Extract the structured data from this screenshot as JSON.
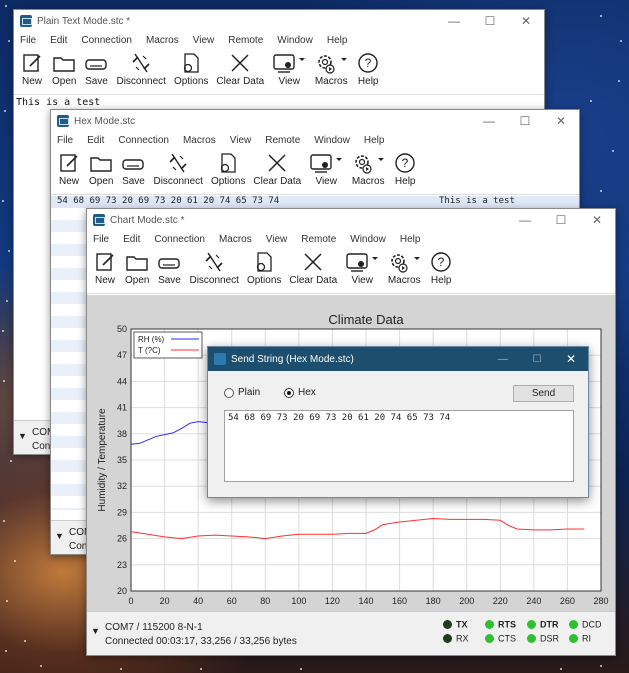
{
  "plain_window": {
    "title": "Plain Text Mode.stc *",
    "text": "This is a test",
    "status_port": "COM",
    "status_conn": "Conn"
  },
  "hex_window": {
    "title": "Hex Mode.stc",
    "hex_text": "54 68 69 73 20 69 73 20 61 20 74 65 73 74",
    "ascii_text": "This is a test",
    "status_port": "COM",
    "status_conn": "Con"
  },
  "chart_window": {
    "title": "Chart Mode.stc *",
    "status_port": "COM7 / 115200 8-N-1",
    "status_conn": "Connected 00:03:17, 33,256 / 33,256 bytes"
  },
  "menu": [
    "File",
    "Edit",
    "Connection",
    "Macros",
    "View",
    "Remote",
    "Window",
    "Help"
  ],
  "toolbar": [
    {
      "label": "New",
      "icon": "new-file-icon"
    },
    {
      "label": "Open",
      "icon": "folder-icon"
    },
    {
      "label": "Save",
      "icon": "save-drive-icon"
    },
    {
      "label": "Disconnect",
      "icon": "disconnect-icon"
    },
    {
      "label": "Options",
      "icon": "options-gear-icon"
    },
    {
      "label": "Clear Data",
      "icon": "clear-x-icon"
    },
    {
      "label": "View",
      "icon": "view-monitor-icon"
    },
    {
      "label": "Macros",
      "icon": "macros-gear-icon"
    },
    {
      "label": "Help",
      "icon": "help-icon"
    }
  ],
  "signals": [
    {
      "label": "TX",
      "state": "dark",
      "bold": true
    },
    {
      "label": "RX",
      "state": "dark",
      "bold": false
    },
    {
      "label": "RTS",
      "state": "on",
      "bold": true
    },
    {
      "label": "CTS",
      "state": "on",
      "bold": false
    },
    {
      "label": "DTR",
      "state": "on",
      "bold": true
    },
    {
      "label": "DSR",
      "state": "on",
      "bold": false
    },
    {
      "label": "DCD",
      "state": "on",
      "bold": false
    },
    {
      "label": "RI",
      "state": "on",
      "bold": false
    }
  ],
  "dialog": {
    "title": "Send String (Hex Mode.stc)",
    "option_plain": "Plain",
    "option_hex": "Hex",
    "selected": "Hex",
    "send_label": "Send",
    "text": "54 68 69 73 20 69 73 20 61 20 74 65 73 74"
  },
  "chart_data": {
    "type": "line",
    "title": "Climate Data",
    "xlabel": "",
    "ylabel": "Humidity / Temperature",
    "xlim": [
      0,
      280
    ],
    "ylim": [
      20,
      50
    ],
    "xticks": [
      0,
      20,
      40,
      60,
      80,
      100,
      120,
      140,
      160,
      180,
      200,
      220,
      240,
      260,
      280
    ],
    "yticks": [
      20,
      23,
      26,
      29,
      32,
      35,
      38,
      41,
      44,
      47,
      50
    ],
    "grid": true,
    "legend": "top-left",
    "series": [
      {
        "name": "RH (%)",
        "color": "#2a2aff",
        "x": [
          0,
          5,
          10,
          15,
          20,
          25,
          30,
          35,
          40,
          45,
          50
        ],
        "values": [
          36.8,
          36.9,
          37.3,
          37.7,
          37.9,
          38.1,
          38.6,
          39.2,
          39.4,
          39.3,
          39.2
        ]
      },
      {
        "name": "T (?C)",
        "color": "#ff3030",
        "x": [
          0,
          10,
          20,
          30,
          40,
          50,
          60,
          70,
          80,
          90,
          100,
          110,
          120,
          130,
          140,
          145,
          150,
          160,
          170,
          180,
          190,
          200,
          210,
          220,
          225,
          230,
          240,
          250,
          260,
          270
        ],
        "values": [
          26.8,
          26.5,
          26.2,
          26.0,
          26.3,
          26.4,
          26.3,
          26.2,
          26.0,
          26.3,
          26.5,
          26.5,
          26.5,
          26.6,
          26.6,
          27.0,
          27.6,
          27.9,
          28.1,
          28.3,
          28.2,
          28.2,
          28.2,
          28.1,
          27.5,
          27.1,
          27.0,
          27.0,
          27.1,
          27.1
        ]
      }
    ]
  }
}
